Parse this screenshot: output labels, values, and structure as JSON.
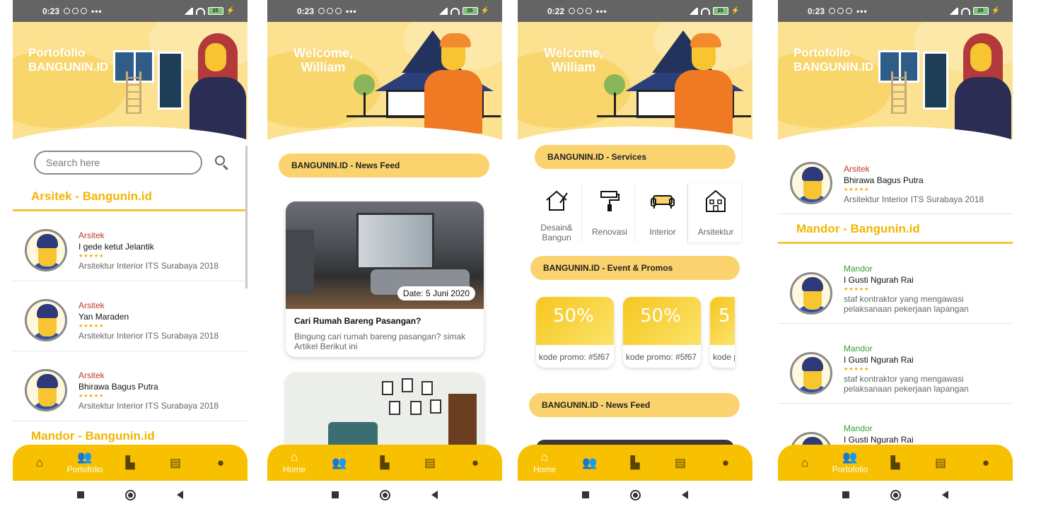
{
  "status": {
    "times": [
      "0:23",
      "0:23",
      "0:22",
      "0:23"
    ],
    "battery": "25"
  },
  "nav": {
    "items": [
      "Portofolio",
      "Home"
    ]
  },
  "screen1": {
    "header_title": "Portofolio BANGUNIN.ID",
    "search_placeholder": "Search here",
    "section_arsitek": "Arsitek - Bangunin.id",
    "section_mandor": "Mandor - Bangunin.id",
    "cards": [
      {
        "role": "Arsitek",
        "name": "I gede ketut Jelantik",
        "stars": "★★★★★",
        "desc": "Arsitektur Interior ITS Surabaya 2018"
      },
      {
        "role": "Arsitek",
        "name": "Yan Maraden",
        "stars": "★★★★★",
        "desc": "Arsitektur Interior ITS Surabaya 2018"
      },
      {
        "role": "Arsitek",
        "name": "Bhirawa Bagus Putra",
        "stars": "★★★★★",
        "desc": "Arsitektur Interior ITS Surabaya 2018"
      }
    ]
  },
  "screen2": {
    "welcome": "Welcome, William",
    "newsfeed": "BANGUNIN.ID - News Feed",
    "news": [
      {
        "date": "Date: 5 Juni 2020",
        "title": "Cari Rumah Bareng Pasangan?",
        "desc": "Bingung cari rumah bareng pasangan? simak Artikel Berikut ini"
      }
    ]
  },
  "screen3": {
    "welcome": "Welcome, William",
    "services_title": "BANGUNIN.ID - Services",
    "services": [
      {
        "label": "Desain& Bangun",
        "icon": "house-design-icon"
      },
      {
        "label": "Renovasi",
        "icon": "paint-roller-icon"
      },
      {
        "label": "Interior",
        "icon": "sofa-icon"
      },
      {
        "label": "Arsitektur",
        "icon": "building-icon"
      }
    ],
    "event_title": "BANGUNIN.ID - Event & Promos",
    "promos": [
      {
        "pct": "50%",
        "label": "kode promo: #5f67"
      },
      {
        "pct": "50%",
        "label": "kode promo: #5f67"
      },
      {
        "pct": "5",
        "label": "kode p"
      }
    ],
    "newsfeed": "BANGUNIN.ID - News Feed"
  },
  "screen4": {
    "header_title": "Portofolio BANGUNIN.ID",
    "top_card": {
      "role": "Arsitek",
      "name": "Bhirawa Bagus Putra",
      "stars": "★★★★★",
      "desc": "Arsitektur Interior ITS Surabaya 2018"
    },
    "section_mandor": "Mandor - Bangunin.id",
    "cards": [
      {
        "role": "Mandor",
        "name": "I Gusti Ngurah Rai",
        "stars": "★★★★★",
        "desc": "staf kontraktor yang mengawasi pelaksanaan pekerjaan lapangan"
      },
      {
        "role": "Mandor",
        "name": "I Gusti Ngurah Rai",
        "stars": "★★★★★",
        "desc": "staf kontraktor yang mengawasi pelaksanaan pekerjaan lapangan"
      },
      {
        "role": "Mandor",
        "name": "I Gusti Ngurah Rai"
      }
    ]
  },
  "colors": {
    "accent": "#f7c000",
    "header_bg": "#fbe190",
    "pill": "#fbd36e",
    "arsitek": "#c0392b",
    "mandor": "#3a9a3a"
  }
}
